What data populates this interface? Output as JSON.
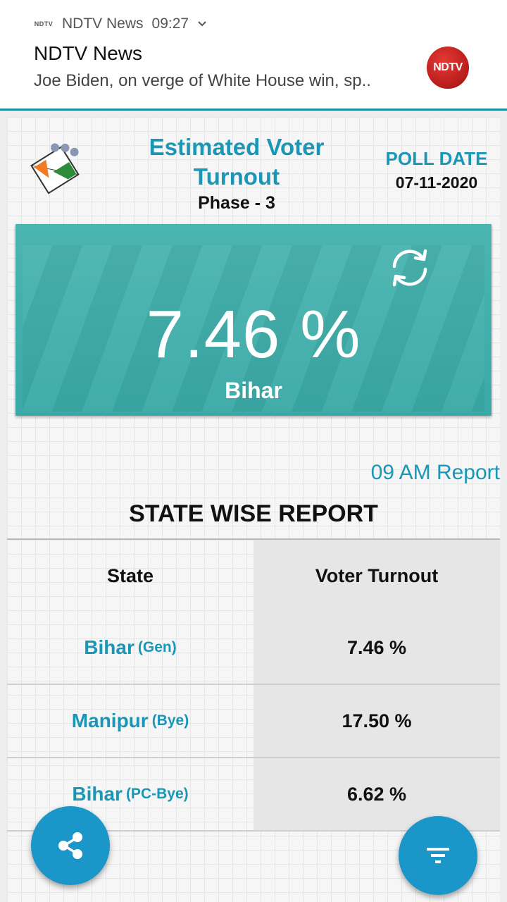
{
  "notification": {
    "app_name": "NDTV News",
    "time": "09:27",
    "title": "NDTV News",
    "text": "Joe Biden, on verge of White House win, sp..",
    "logo_text": "NDTV",
    "mini_logo_text": "NDTV"
  },
  "header": {
    "title": "Estimated Voter Turnout",
    "phase": "Phase - 3",
    "poll_date_label": "POLL DATE",
    "poll_date": "07-11-2020"
  },
  "summary": {
    "turnout": "7.46 %",
    "state": "Bihar"
  },
  "report": {
    "time_label": "09 AM Report",
    "section_title": "STATE WISE REPORT",
    "columns": [
      "State",
      "Voter Turnout"
    ],
    "rows": [
      {
        "state": "Bihar",
        "type": "(Gen)",
        "turnout": "7.46 %"
      },
      {
        "state": "Manipur",
        "type": "(Bye)",
        "turnout": "17.50 %"
      },
      {
        "state": "Bihar",
        "type": "(PC-Bye)",
        "turnout": "6.62 %"
      }
    ]
  },
  "colors": {
    "accent": "#1a96b7",
    "card": "#3aa9a7",
    "fab": "#1a96c8"
  },
  "icons": {
    "refresh": "refresh-icon",
    "share": "share-icon",
    "filter": "filter-icon",
    "expand": "chevron-down-icon"
  }
}
